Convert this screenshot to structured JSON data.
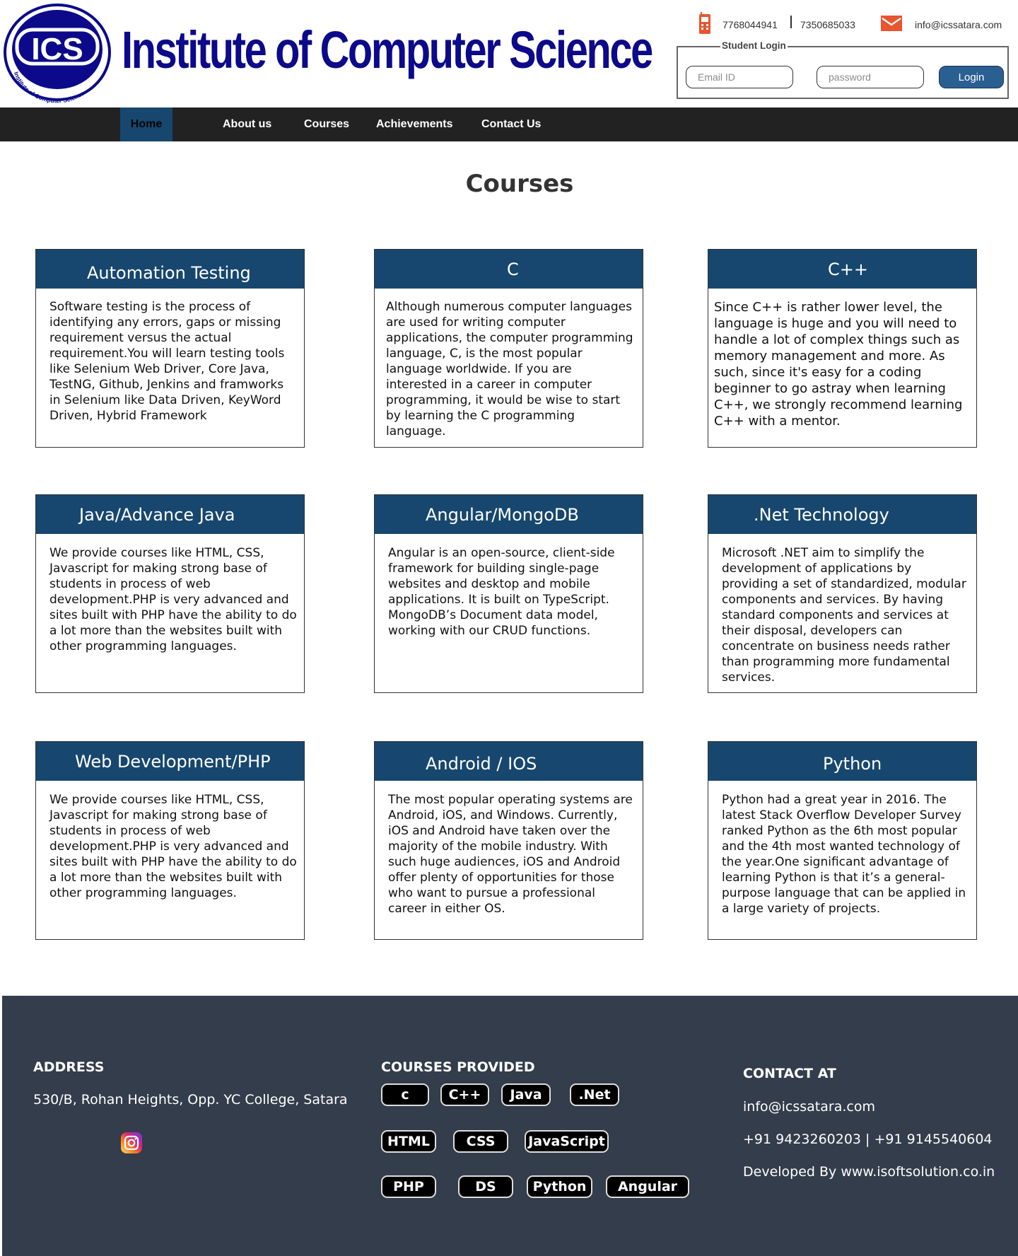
{
  "header": {
    "site_title": "Institute of Computer Science",
    "logo": {
      "text": "ICS",
      "ring_text": "Institute of Computer Science."
    },
    "phone_1": "7768044941",
    "phone_2": "7350685033",
    "email": "info@icssatara.com",
    "login": {
      "legend": "Student Login",
      "email_placeholder": "Email ID",
      "password_placeholder": "password",
      "button_label": "Login"
    },
    "colors": {
      "title": "#0c0a8a",
      "icon_accent": "#e8552f",
      "login_button": "#2a5f92"
    }
  },
  "nav": {
    "items": [
      {
        "label": "Home",
        "active": true
      },
      {
        "label": "About us"
      },
      {
        "label": "Courses"
      },
      {
        "label": "Achievements"
      },
      {
        "label": "Contact Us"
      }
    ]
  },
  "main": {
    "title": "Courses",
    "courses": [
      {
        "title": "Automation Testing",
        "description": "Software testing is the process of identifying any errors, gaps or missing requirement versus the actual requirement.You will learn testing tools like Selenium Web Driver, Core Java, TestNG, Github, Jenkins and framworks in Selenium like Data Driven, KeyWord Driven, Hybrid Framework"
      },
      {
        "title": "C",
        "description": "Although numerous computer languages are used for writing computer applications, the computer programming language, C, is the most popular language worldwide. If you are interested in a career in computer programming, it would be wise to start by learning the C programming language."
      },
      {
        "title": "C++",
        "description": "Since C++ is rather lower level, the language is huge and you will need to handle a lot of complex things such as memory management and more. As such, since it's easy for a coding beginner to go astray when learning C++, we strongly recommend learning C++ with a mentor."
      },
      {
        "title": "Java/Advance Java",
        "description": "We provide courses like HTML, CSS, Javascript for making strong base of students in process of web development.PHP is very advanced and sites built with PHP have the ability to do a lot more than the websites built with other programming languages."
      },
      {
        "title": "Angular/MongoDB",
        "description": "Angular is an open-source, client-side framework for building single-page websites and desktop and mobile applications. It is built on TypeScript. MongoDB’s Document data model, working with our CRUD functions."
      },
      {
        "title": ".Net Technology",
        "description": "Microsoft .NET aim to simplify the development of applications by providing a set of standardized, modular components and services. By having standard components and services at their disposal, developers can concentrate on business needs rather than programming more fundamental services."
      },
      {
        "title": "Web Development/PHP",
        "description": "We provide courses like HTML, CSS, Javascript for making strong base of students in process of web development.PHP is very advanced and sites built with PHP have the ability to do a lot more than the websites built with other programming languages."
      },
      {
        "title": "Android / IOS",
        "description": "The most popular operating systems are Android, iOS, and Windows. Currently, iOS and Android have taken over the majority of the mobile industry. With such huge audiences, iOS and Android offer plenty of opportunities for those who want to pursue a professional career in either OS."
      },
      {
        "title": "Python",
        "description": "Python had a great year in 2016. The latest Stack Overflow Developer Survey ranked Python as the 6th most popular and the 4th most wanted technology of the year.One significant advantage of learning Python is that it’s a general-purpose language that can be applied in a large variety of projects."
      }
    ],
    "colors": {
      "card_header": "#17476e"
    }
  },
  "footer": {
    "address_heading": "ADDRESS",
    "address": "530/B, Rohan Heights, Opp. YC College, Satara",
    "social_icon": "instagram-icon",
    "courses_heading": "COURSES PROVIDED",
    "course_chips": [
      "c",
      "C++",
      "Java",
      ".Net",
      "HTML",
      "CSS",
      "JavaScript",
      "PHP",
      "DS",
      "Python",
      "Angular"
    ],
    "contact_heading": "CONTACT AT",
    "email": "info@icssatara.com",
    "phones": "+91 9423260203 | +91 9145540604",
    "developed_by": "Developed By www.isoftsolution.co.in",
    "colors": {
      "background": "#333d4b"
    }
  }
}
